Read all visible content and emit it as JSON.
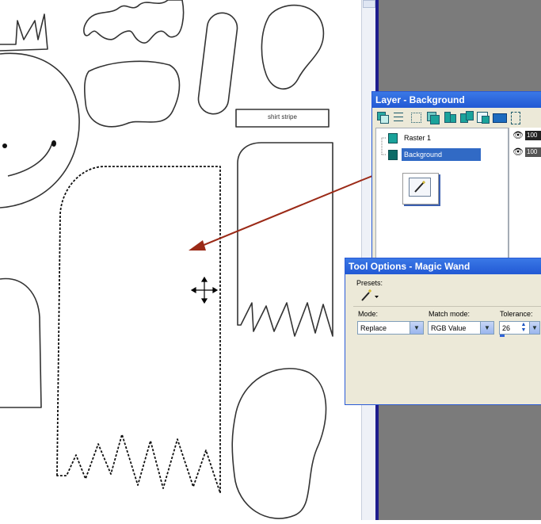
{
  "canvas": {
    "shirt_stripe_label": "shirt stripe"
  },
  "layer_panel": {
    "title": "Layer - Background",
    "layers": [
      {
        "name": "Raster 1",
        "opacity": "100",
        "selected": false
      },
      {
        "name": "Background",
        "opacity": "100",
        "selected": true
      }
    ]
  },
  "tool_panel": {
    "title": "Tool Options - Magic Wand",
    "presets_label": "Presets:",
    "mode_label": "Mode:",
    "mode_value": "Replace",
    "match_label": "Match mode:",
    "match_value": "RGB Value",
    "tolerance_label": "Tolerance:",
    "tolerance_value": "26"
  },
  "colors": {
    "arrow": "#9b2a17",
    "titlebar": "#2a63d8",
    "panel_bg": "#ece9d8",
    "selection": "#316ac5",
    "workspace": "#7b7b7b"
  },
  "icons": [
    "magic-wand-icon",
    "eye-icon",
    "layer-icon",
    "move-cursor-icon",
    "dropdown-arrow-icon",
    "spinner-icon"
  ]
}
